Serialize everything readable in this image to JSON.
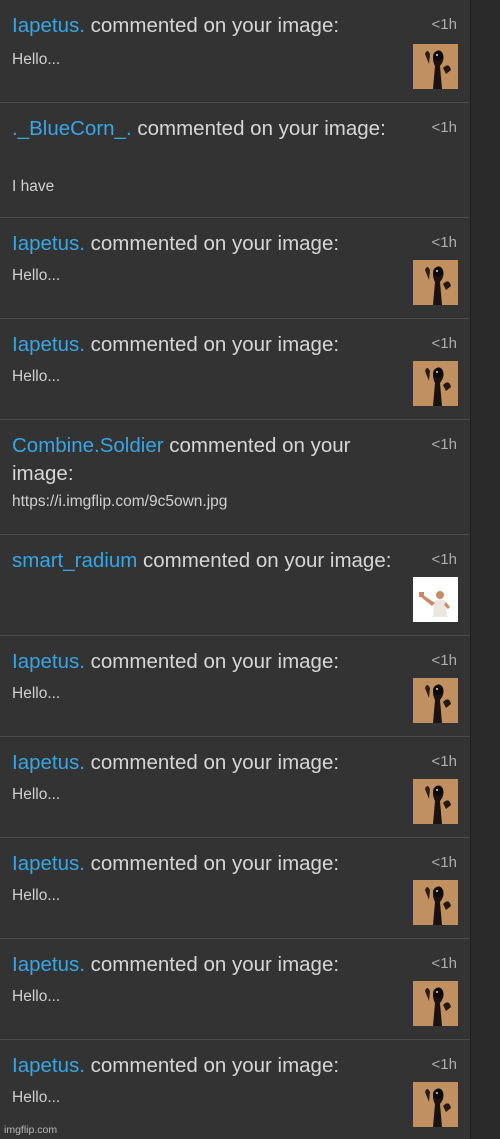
{
  "verb": "commented on your image:",
  "watermark": "imgflip.com",
  "colors": {
    "username": "#35a6e6",
    "background": "#333333",
    "text": "#d6d6d6"
  },
  "notifications": [
    {
      "user": "Iapetus.",
      "action": "commented on your image:",
      "snippet": "Hello...",
      "time": "<1h",
      "thumbnail": "dark-figure-thumbnail"
    },
    {
      "user": "._BlueCorn_.",
      "action": "commented on your image:",
      "snippet": "I have",
      "time": "<1h",
      "thumbnail": ""
    },
    {
      "user": "Iapetus.",
      "action": "commented on your image:",
      "snippet": "Hello...",
      "time": "<1h",
      "thumbnail": "dark-figure-thumbnail"
    },
    {
      "user": "Iapetus.",
      "action": "commented on your image:",
      "snippet": "Hello...",
      "time": "<1h",
      "thumbnail": "dark-figure-thumbnail"
    },
    {
      "user": "Combine.Soldier",
      "action": "commented on your image:",
      "snippet": "https://i.imgflip.com/9c5own.jpg",
      "time": "<1h",
      "thumbnail": ""
    },
    {
      "user": "smart_radium",
      "action": "commented on your image:",
      "snippet": "",
      "time": "<1h",
      "thumbnail": "man-pointing-thumbnail"
    },
    {
      "user": "Iapetus.",
      "action": "commented on your image:",
      "snippet": "Hello...",
      "time": "<1h",
      "thumbnail": "dark-figure-thumbnail"
    },
    {
      "user": "Iapetus.",
      "action": "commented on your image:",
      "snippet": "Hello...",
      "time": "<1h",
      "thumbnail": "dark-figure-thumbnail"
    },
    {
      "user": "Iapetus.",
      "action": "commented on your image:",
      "snippet": "Hello...",
      "time": "<1h",
      "thumbnail": "dark-figure-thumbnail"
    },
    {
      "user": "Iapetus.",
      "action": "commented on your image:",
      "snippet": "Hello...",
      "time": "<1h",
      "thumbnail": "dark-figure-thumbnail"
    },
    {
      "user": "Iapetus.",
      "action": "commented on your image:",
      "snippet": "Hello...",
      "time": "<1h",
      "thumbnail": "dark-figure-thumbnail"
    }
  ]
}
